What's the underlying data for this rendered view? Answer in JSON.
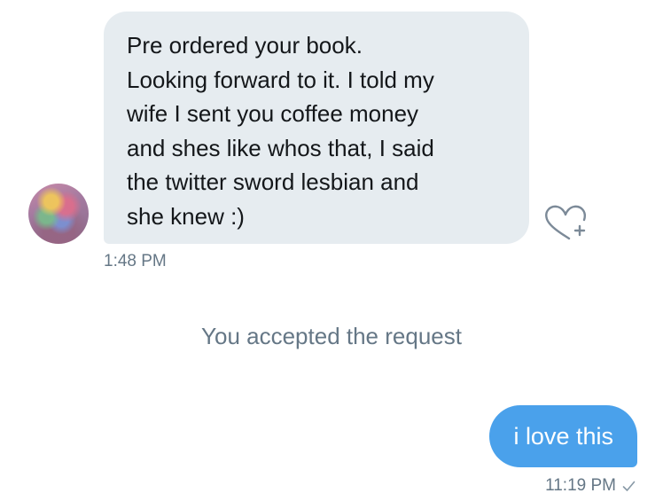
{
  "conversation": {
    "incoming": {
      "text": "Pre ordered your book.\nLooking forward to it.  I told my\nwife I sent you coffee money\nand shes like whos that, I said\nthe twitter sword lesbian and\nshe knew :)",
      "time": "1:48 PM",
      "avatar_icon": "user-avatar",
      "like_icon": "heart-plus-icon"
    },
    "system_message": "You accepted the request",
    "outgoing": {
      "text": "i love this",
      "time": "11:19 PM",
      "status_icon": "checkmark-icon"
    }
  },
  "colors": {
    "incoming_bubble": "#e6ecf0",
    "outgoing_bubble": "#4aa1eb",
    "meta_text": "#657786"
  }
}
